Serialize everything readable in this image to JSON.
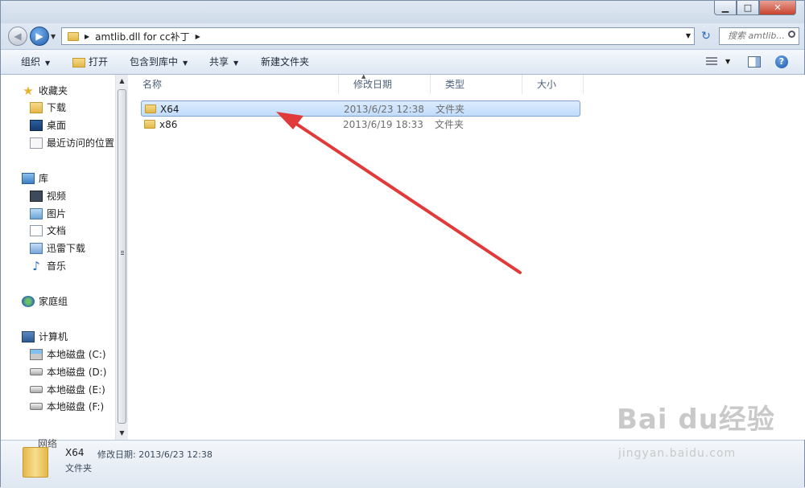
{
  "address": {
    "path": "amtlib.dll for cc补丁",
    "search_placeholder": "搜索 amtlib..."
  },
  "toolbar": {
    "organize": "组织",
    "open": "打开",
    "include_in_library": "包含到库中",
    "share": "共享",
    "new_folder": "新建文件夹"
  },
  "nav": {
    "favorites": "收藏夹",
    "downloads": "下载",
    "desktop": "桌面",
    "recent": "最近访问的位置",
    "libraries": "库",
    "videos": "视频",
    "pictures": "图片",
    "documents": "文档",
    "thunder": "迅雷下载",
    "music": "音乐",
    "homegroup": "家庭组",
    "computer": "计算机",
    "drive_c": "本地磁盘 (C:)",
    "drive_d": "本地磁盘 (D:)",
    "drive_e": "本地磁盘 (E:)",
    "drive_f": "本地磁盘 (F:)",
    "network": "网络"
  },
  "columns": {
    "name": "名称",
    "modified": "修改日期",
    "type": "类型",
    "size": "大小"
  },
  "files": [
    {
      "name": "X64",
      "modified": "2013/6/23 12:38",
      "type": "文件夹",
      "size": ""
    },
    {
      "name": "x86",
      "modified": "2013/6/19 18:33",
      "type": "文件夹",
      "size": ""
    }
  ],
  "details": {
    "name": "X64",
    "modified_label": "修改日期:",
    "modified": "2013/6/23 12:38",
    "type": "文件夹"
  },
  "watermark": {
    "brand": "Bai du经验",
    "site": "jingyan.baidu.com"
  },
  "colors": {
    "arrow": "#e03a3a",
    "selection": "#c1dcfc",
    "toolbar": "#dde7f3"
  }
}
